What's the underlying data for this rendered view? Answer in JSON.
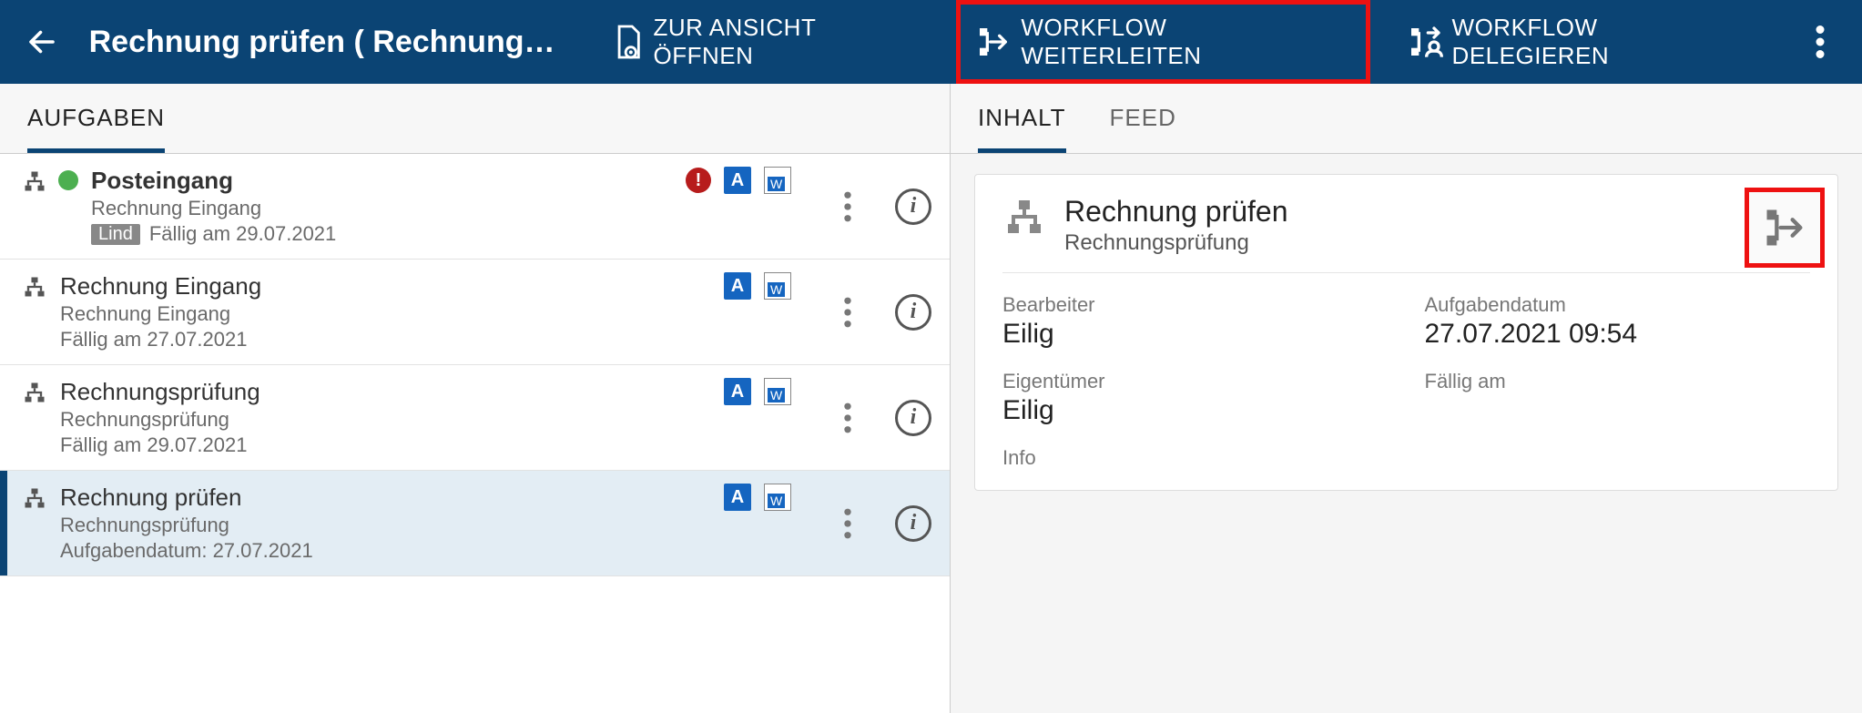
{
  "header": {
    "title": "Rechnung prüfen ( Rechnung…",
    "open_view": "ZUR ANSICHT ÖFFNEN",
    "forward": "WORKFLOW WEITERLEITEN",
    "delegate": "WORKFLOW DELEGIEREN"
  },
  "left": {
    "tab": "AUFGABEN"
  },
  "right": {
    "tab_content": "INHALT",
    "tab_feed": "FEED"
  },
  "tasks": [
    {
      "title": "Posteingang",
      "bold": true,
      "has_status_dot": true,
      "subtitle": "Rechnung Eingang",
      "badge": "Lind",
      "meta": "Fällig am 29.07.2021",
      "urgent": true
    },
    {
      "title": "Rechnung Eingang",
      "subtitle": "Rechnung Eingang",
      "meta": "Fällig am 27.07.2021"
    },
    {
      "title": "Rechnungsprüfung",
      "subtitle": "Rechnungsprüfung",
      "meta": "Fällig am 29.07.2021"
    },
    {
      "title": "Rechnung prüfen",
      "subtitle": "Rechnungsprüfung",
      "meta": "Aufgabendatum: 27.07.2021",
      "selected": true
    }
  ],
  "detail": {
    "title": "Rechnung prüfen",
    "subtitle": "Rechnungsprüfung",
    "fields": {
      "bearbeiter_label": "Bearbeiter",
      "bearbeiter_value": "Eilig",
      "aufgabendatum_label": "Aufgabendatum",
      "aufgabendatum_value": "27.07.2021 09:54",
      "eigentuemer_label": "Eigentümer",
      "eigentuemer_value": "Eilig",
      "faellig_label": "Fällig am",
      "faellig_value": "",
      "info_label": "Info"
    }
  }
}
